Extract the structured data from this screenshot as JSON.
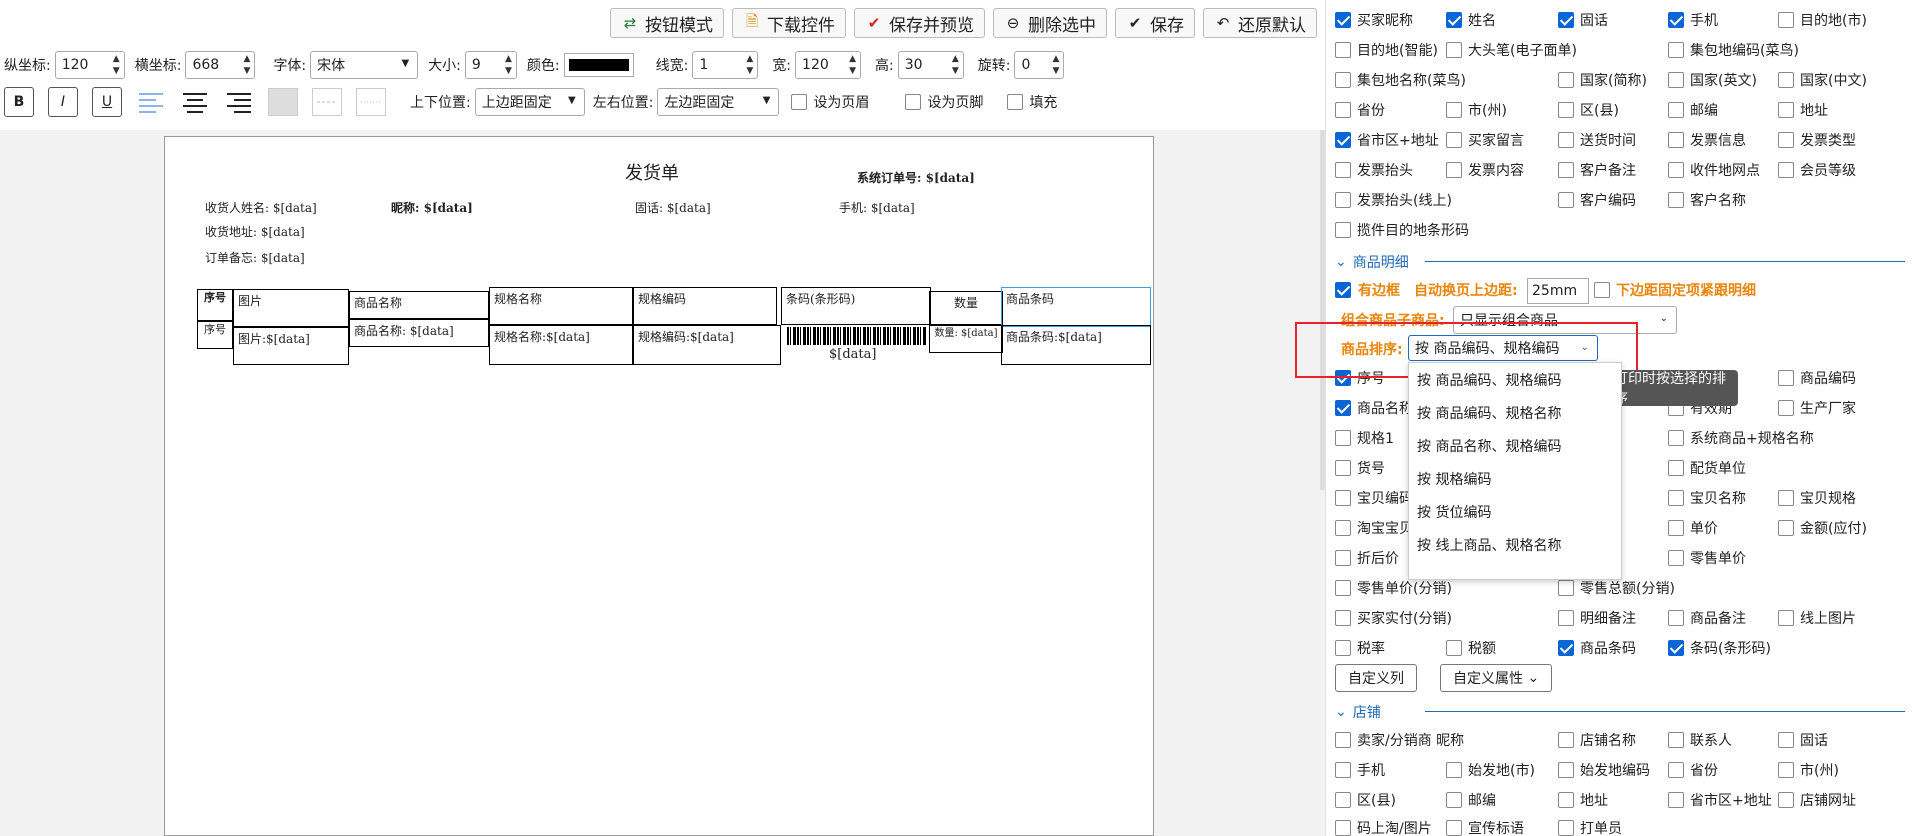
{
  "toolbar": {
    "buttons": [
      "按钮模式",
      "下载控件",
      "保存并预览",
      "删除选中",
      "保存",
      "还原默认"
    ]
  },
  "props": {
    "y_label": "纵坐标:",
    "y_value": "120",
    "x_label": "横坐标:",
    "x_value": "668",
    "font_label": "字体:",
    "font_value": "宋体",
    "size_label": "大小:",
    "size_value": "9",
    "color_label": "颜色:",
    "linewidth_label": "线宽:",
    "linewidth_value": "1",
    "width_label": "宽:",
    "width_value": "120",
    "height_label": "高:",
    "height_value": "30",
    "rotate_label": "旋转:",
    "rotate_value": "0",
    "bold": "B",
    "italic": "I",
    "underline": "U",
    "vpos_label": "上下位置:",
    "vpos_value": "上边距固定",
    "hpos_label": "左右位置:",
    "hpos_value": "左边距固定",
    "header_label": "设为页眉",
    "footer_label": "设为页脚",
    "fill_label": "填充"
  },
  "paper": {
    "title": "发货单",
    "order_no": "系统订单号: $[data]",
    "receiver": "收货人姓名: $[data]",
    "nickname": "昵称: $[data]",
    "phone": "固话: $[data]",
    "mobile": "手机: $[data]",
    "address": "收货地址: $[data]",
    "remark": "订单备忘: $[data]",
    "headers": [
      "序号",
      "图片",
      "商品名称",
      "规格名称",
      "规格编码",
      "条码(条形码)",
      "数量",
      "商品条码"
    ],
    "cells": [
      "序号",
      "图片:$[data]",
      "商品名称: $[data]",
      "规格名称:$[data]",
      "规格编码:$[data]",
      "$[data]",
      "数量: $[data]",
      "商品条码:$[data]"
    ]
  },
  "panel": {
    "row_buyer": [
      "买家昵称",
      "姓名",
      "固话",
      "手机",
      "目的地(市)"
    ],
    "row2": [
      "目的地(智能)",
      "大头笔(电子面单)",
      "集包地编码(菜鸟)"
    ],
    "row3": [
      "集包地名称(菜鸟)",
      "国家(简称)",
      "国家(英文)",
      "国家(中文)"
    ],
    "row4": [
      "省份",
      "市(州)",
      "区(县)",
      "邮编",
      "地址"
    ],
    "row5": [
      "省市区+地址",
      "买家留言",
      "送货时间",
      "发票信息",
      "发票类型"
    ],
    "row6": [
      "发票抬头",
      "发票内容",
      "客户备注",
      "收件地网点",
      "会员等级"
    ],
    "row7": [
      "发票抬头(线上)",
      "客户编码",
      "客户名称"
    ],
    "row8": [
      "揽件目的地条形码"
    ],
    "section_goods": "商品明细",
    "has_border": "有边框",
    "auto_page_label": "自动换页上边距:",
    "auto_page_value": "25mm",
    "bottom_fixed": "下边距固定项紧跟明细",
    "combo_label": "组合商品子商品:",
    "combo_value": "只显示组合商品",
    "sort_label": "商品排序:",
    "sort_value": "按 商品编码、规格编码",
    "sort_options": [
      "按 商品编码、规格编码",
      "按 商品编码、规格名称",
      "按 商品名称、规格编码",
      "按 规格编码",
      "按 货位编码",
      "按 线上商品、规格名称"
    ],
    "tooltip": "打印时按选择的排序",
    "g1": [
      "序号",
      "商品编码"
    ],
    "g2": [
      "商品名称",
      "有效期",
      "生产厂家"
    ],
    "g3": [
      "规格1",
      "系统商品+规格名称"
    ],
    "g4": [
      "货号",
      "配货单位"
    ],
    "g5": [
      "宝贝编码",
      "宝贝名称",
      "宝贝规格"
    ],
    "g6": [
      "淘宝宝贝",
      "单价",
      "金额(应付)"
    ],
    "g7": [
      "折后价",
      "零售单价"
    ],
    "g8": [
      "零售单价(分销)",
      "零售总额(分销)"
    ],
    "g9": [
      "买家实付(分销)",
      "明细备注",
      "商品备注",
      "线上图片"
    ],
    "g10": [
      "税率",
      "税额",
      "商品条码",
      "条码(条形码)"
    ],
    "custom_col": "自定义列",
    "custom_attr": "自定义属性",
    "section_shop": "店铺",
    "s1": [
      "卖家/分销商 昵称",
      "店铺名称",
      "联系人",
      "固话"
    ],
    "s2": [
      "手机",
      "始发地(市)",
      "始发地编码",
      "省份",
      "市(州)"
    ],
    "s3": [
      "区(县)",
      "邮编",
      "地址",
      "省市区+地址",
      "店铺网址"
    ],
    "s4": [
      "码上淘/图片",
      "宣传标语",
      "打单员"
    ]
  }
}
